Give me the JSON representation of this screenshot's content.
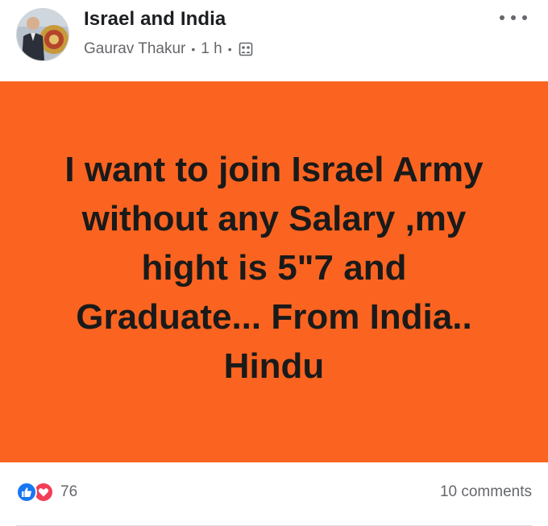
{
  "post": {
    "group_name": "Israel and India",
    "author": "Gaurav Thakur",
    "time": "1 h",
    "separator": "•",
    "privacy_icon": "group-privacy-icon",
    "more_icon": "more-options-icon"
  },
  "content": {
    "background_color": "#fb6420",
    "text_color": "#1a1a1a",
    "lines": [
      "I want to join Israel Army",
      "without any Salary ,my",
      "hight is 5\"7 and",
      "Graduate... From India..",
      "Hindu"
    ]
  },
  "footer": {
    "reaction_icons": [
      "like-icon",
      "love-icon"
    ],
    "reaction_count": "76",
    "comments": "10 comments"
  },
  "colors": {
    "like": "#1877f2",
    "love": "#f33e58",
    "secondary_text": "#65676b"
  }
}
